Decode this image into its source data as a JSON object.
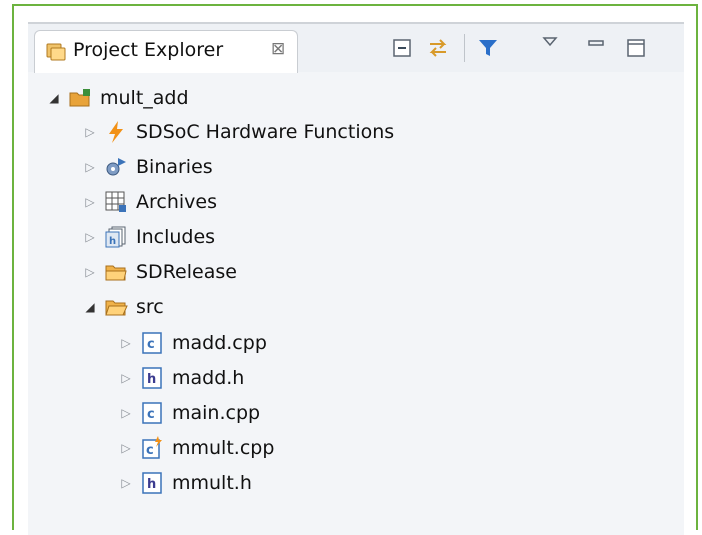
{
  "tab": {
    "title": "Project Explorer",
    "close_symbol": "⊠"
  },
  "toolbar": {
    "collapse_all": "collapse-all-icon",
    "link_editor": "link-with-editor-icon",
    "filter": "filter-icon",
    "view_menu": "view-menu-icon",
    "minimize": "minimize-icon",
    "maximize": "maximize-icon"
  },
  "tree": {
    "project": {
      "label": "mult_add",
      "expanded": true
    },
    "items": [
      {
        "label": "SDSoC Hardware Functions",
        "icon": "lightning-icon"
      },
      {
        "label": "Binaries",
        "icon": "binaries-icon"
      },
      {
        "label": "Archives",
        "icon": "archives-icon"
      },
      {
        "label": "Includes",
        "icon": "includes-icon"
      },
      {
        "label": "SDRelease",
        "icon": "folder-icon"
      },
      {
        "label": "src",
        "icon": "folder-open-icon",
        "expanded": true
      }
    ],
    "src_files": [
      {
        "label": "madd.cpp",
        "icon": "c-file-icon"
      },
      {
        "label": "madd.h",
        "icon": "h-file-icon"
      },
      {
        "label": "main.cpp",
        "icon": "c-file-icon"
      },
      {
        "label": "mmult.cpp",
        "icon": "c-file-hw-icon"
      },
      {
        "label": "mmult.h",
        "icon": "h-file-icon"
      }
    ]
  },
  "colors": {
    "frame_border": "#6cb33f",
    "folder": "#e8a33a",
    "lightning": "#f29116",
    "file_c": "#3b73b9",
    "filter": "#2a6fc9"
  }
}
